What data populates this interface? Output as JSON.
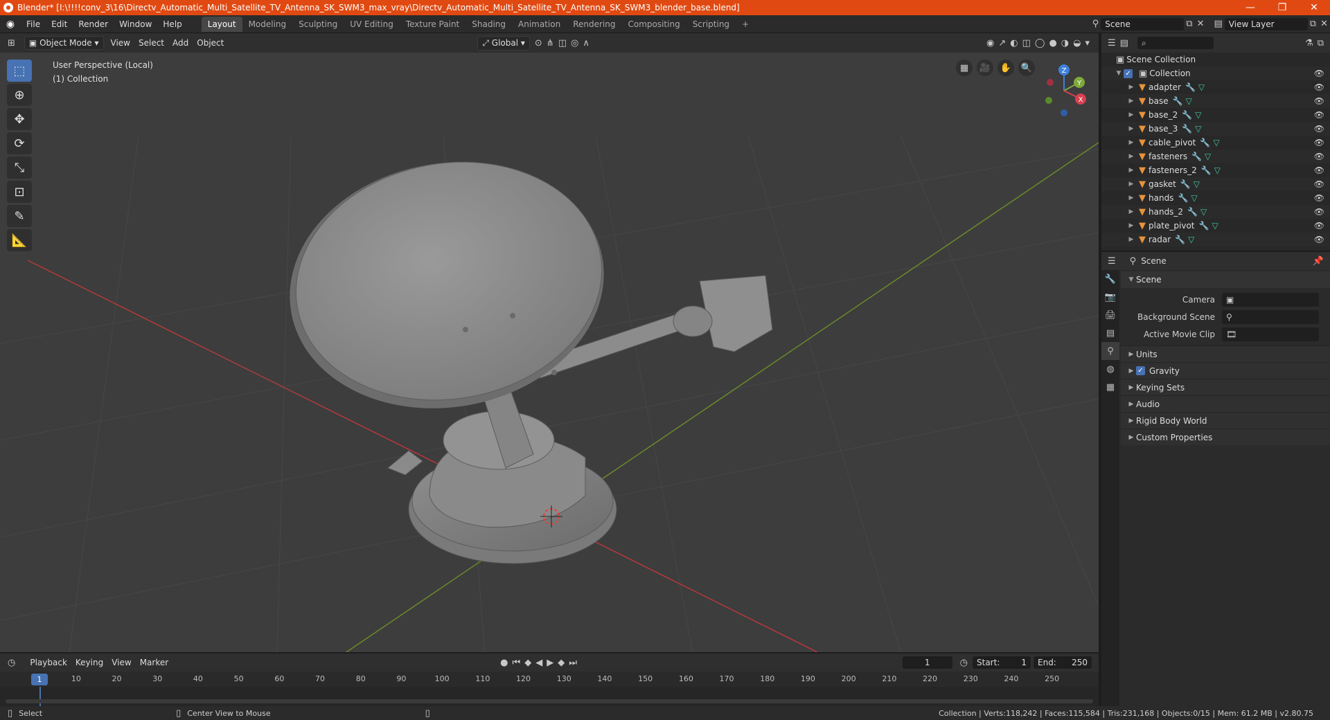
{
  "titlebar": {
    "title": "Blender* [I:\\!!!!conv_3\\16\\Directv_Automatic_Multi_Satellite_TV_Antenna_SK_SWM3_max_vray\\Directv_Automatic_Multi_Satellite_TV_Antenna_SK_SWM3_blender_base.blend]",
    "minimize": "—",
    "maximize": "❐",
    "close": "✕"
  },
  "menu": [
    "File",
    "Edit",
    "Render",
    "Window",
    "Help"
  ],
  "workspaces": [
    "Layout",
    "Modeling",
    "Sculpting",
    "UV Editing",
    "Texture Paint",
    "Shading",
    "Animation",
    "Rendering",
    "Compositing",
    "Scripting"
  ],
  "add_workspace": "+",
  "scene_field": "Scene",
  "view_layer_field": "View Layer",
  "viewport_header": {
    "mode": "Object Mode",
    "menus": [
      "View",
      "Select",
      "Add",
      "Object"
    ],
    "orientation": "Global"
  },
  "viewport": {
    "perspective": "User Perspective (Local)",
    "collection": "(1) Collection",
    "gizmo": {
      "x": "X",
      "y": "Y",
      "z": "Z"
    }
  },
  "outliner": {
    "scene_collection": "Scene Collection",
    "collection": "Collection",
    "objects": [
      "adapter",
      "base",
      "base_2",
      "base_3",
      "cable_pivot",
      "fasteners",
      "fasteners_2",
      "gasket",
      "hands",
      "hands_2",
      "plate_pivot",
      "radar"
    ]
  },
  "properties": {
    "header_scene": "Scene",
    "panel_scene": "Scene",
    "camera_label": "Camera",
    "background_scene_label": "Background Scene",
    "active_movie_clip_label": "Active Movie Clip",
    "subpanels": [
      "Units",
      "Gravity",
      "Keying Sets",
      "Audio",
      "Rigid Body World",
      "Custom Properties"
    ],
    "gravity_checked": true
  },
  "timeline": {
    "menus": [
      "Playback",
      "Keying",
      "View",
      "Marker"
    ],
    "current_frame": "1",
    "start_label": "Start:",
    "start": "1",
    "end_label": "End:",
    "end": "250",
    "ruler_current": "1",
    "ruler": [
      "10",
      "20",
      "30",
      "40",
      "50",
      "60",
      "70",
      "80",
      "90",
      "100",
      "110",
      "120",
      "130",
      "140",
      "150",
      "160",
      "170",
      "180",
      "190",
      "200",
      "210",
      "220",
      "230",
      "240",
      "250"
    ]
  },
  "statusbar": {
    "select": "Select",
    "center_view": "Center View to Mouse",
    "stats": "Collection | Verts:118,242 | Faces:115,584 | Tris:231,168 | Objects:0/15 | Mem: 61.2 MB | v2.80.75"
  },
  "colors": {
    "title_bar": "#e04a12",
    "accent": "#4772b3",
    "object_icon": "#e8933b",
    "axis_x": "#b33a3a",
    "axis_y": "#6a8a2a"
  }
}
